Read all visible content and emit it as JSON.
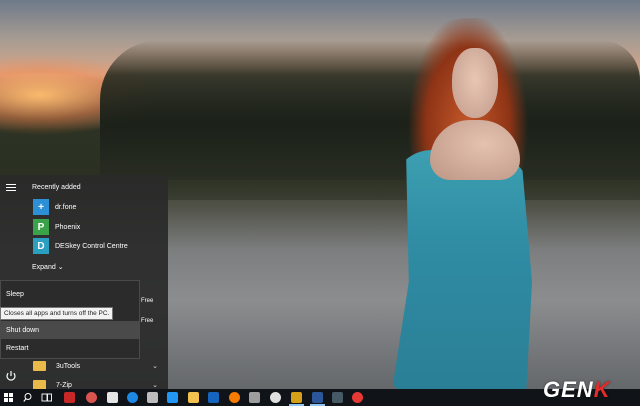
{
  "start_menu": {
    "recently_added_title": "Recently added",
    "recent_apps": [
      {
        "label": "dr.fone",
        "icon": "drfone-icon",
        "color": "#2d8fd5",
        "glyph": "+"
      },
      {
        "label": "Phoenix",
        "icon": "phoenix-icon",
        "color": "#3aa34a",
        "glyph": "P"
      },
      {
        "label": "DESkey Control Centre",
        "icon": "deskey-icon",
        "color": "#2a9fbf",
        "glyph": "D"
      }
    ],
    "expand_label": "Expand",
    "free_label_1": "Free",
    "free_label_2": "Free",
    "folders": [
      {
        "label": "3uTools",
        "icon": "folder-icon"
      },
      {
        "label": "7-Zip",
        "icon": "folder-icon"
      }
    ]
  },
  "power_menu": {
    "sleep_label": "Sleep",
    "tooltip": "Closes all apps and turns off the PC.",
    "shutdown_label": "Shut down",
    "restart_label": "Restart"
  },
  "taskbar": {
    "icons": [
      "windows-start-icon",
      "search-icon",
      "task-view-icon",
      "app-icon",
      "app-icon",
      "store-icon",
      "edge-icon",
      "file-explorer-icon",
      "mail-icon",
      "app-icon",
      "firefox-icon",
      "app-icon",
      "app-icon",
      "app-icon",
      "media-icon",
      "word-icon",
      "app-icon",
      "chrome-icon"
    ]
  },
  "watermark": {
    "text_main": "GEN",
    "text_accent": "K"
  },
  "colors": {
    "menu_bg": "#2a2a2a",
    "highlight": "#4a4a4a",
    "accent_red": "#e22b2b",
    "folder": "#e9b949"
  }
}
